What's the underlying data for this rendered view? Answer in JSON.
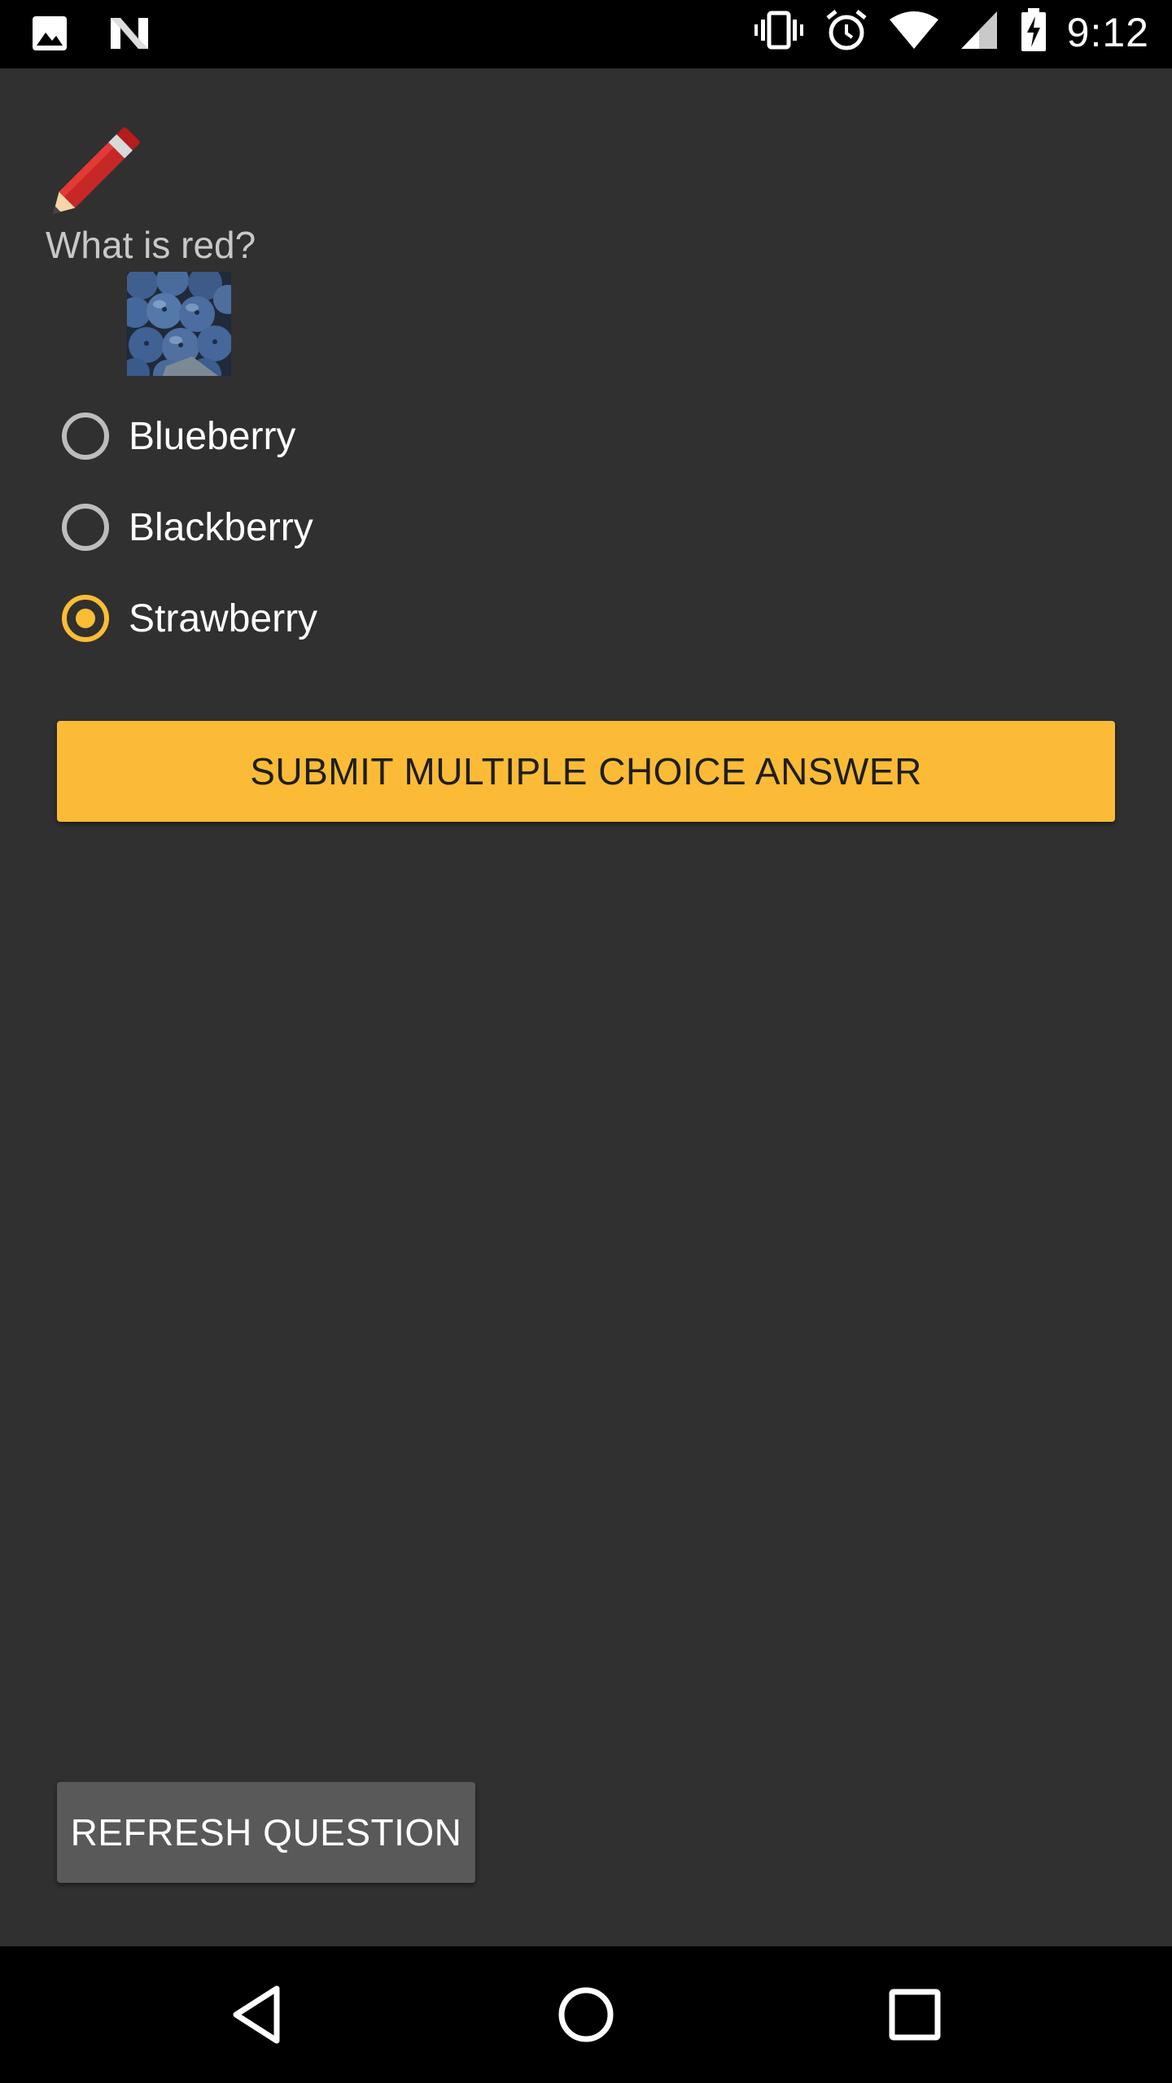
{
  "status_bar": {
    "time": "9:12",
    "left_icons": [
      "image-icon",
      "n-notification-icon"
    ],
    "right_icons": [
      "vibrate-icon",
      "alarm-icon",
      "wifi-icon",
      "signal-icon",
      "battery-charging-icon"
    ]
  },
  "quiz": {
    "question": "What is red?",
    "image": "blueberries-image",
    "options": [
      {
        "label": "Blueberry",
        "selected": false
      },
      {
        "label": "Blackberry",
        "selected": false
      },
      {
        "label": "Strawberry",
        "selected": true
      }
    ],
    "submit_label": "SUBMIT MULTIPLE CHOICE ANSWER",
    "refresh_label": "REFRESH QUESTION"
  },
  "colors": {
    "background": "#303030",
    "accent": "#fbbb36",
    "secondary_button": "#595959"
  },
  "nav_bar": {
    "items": [
      "back-icon",
      "home-icon",
      "recents-icon"
    ]
  }
}
